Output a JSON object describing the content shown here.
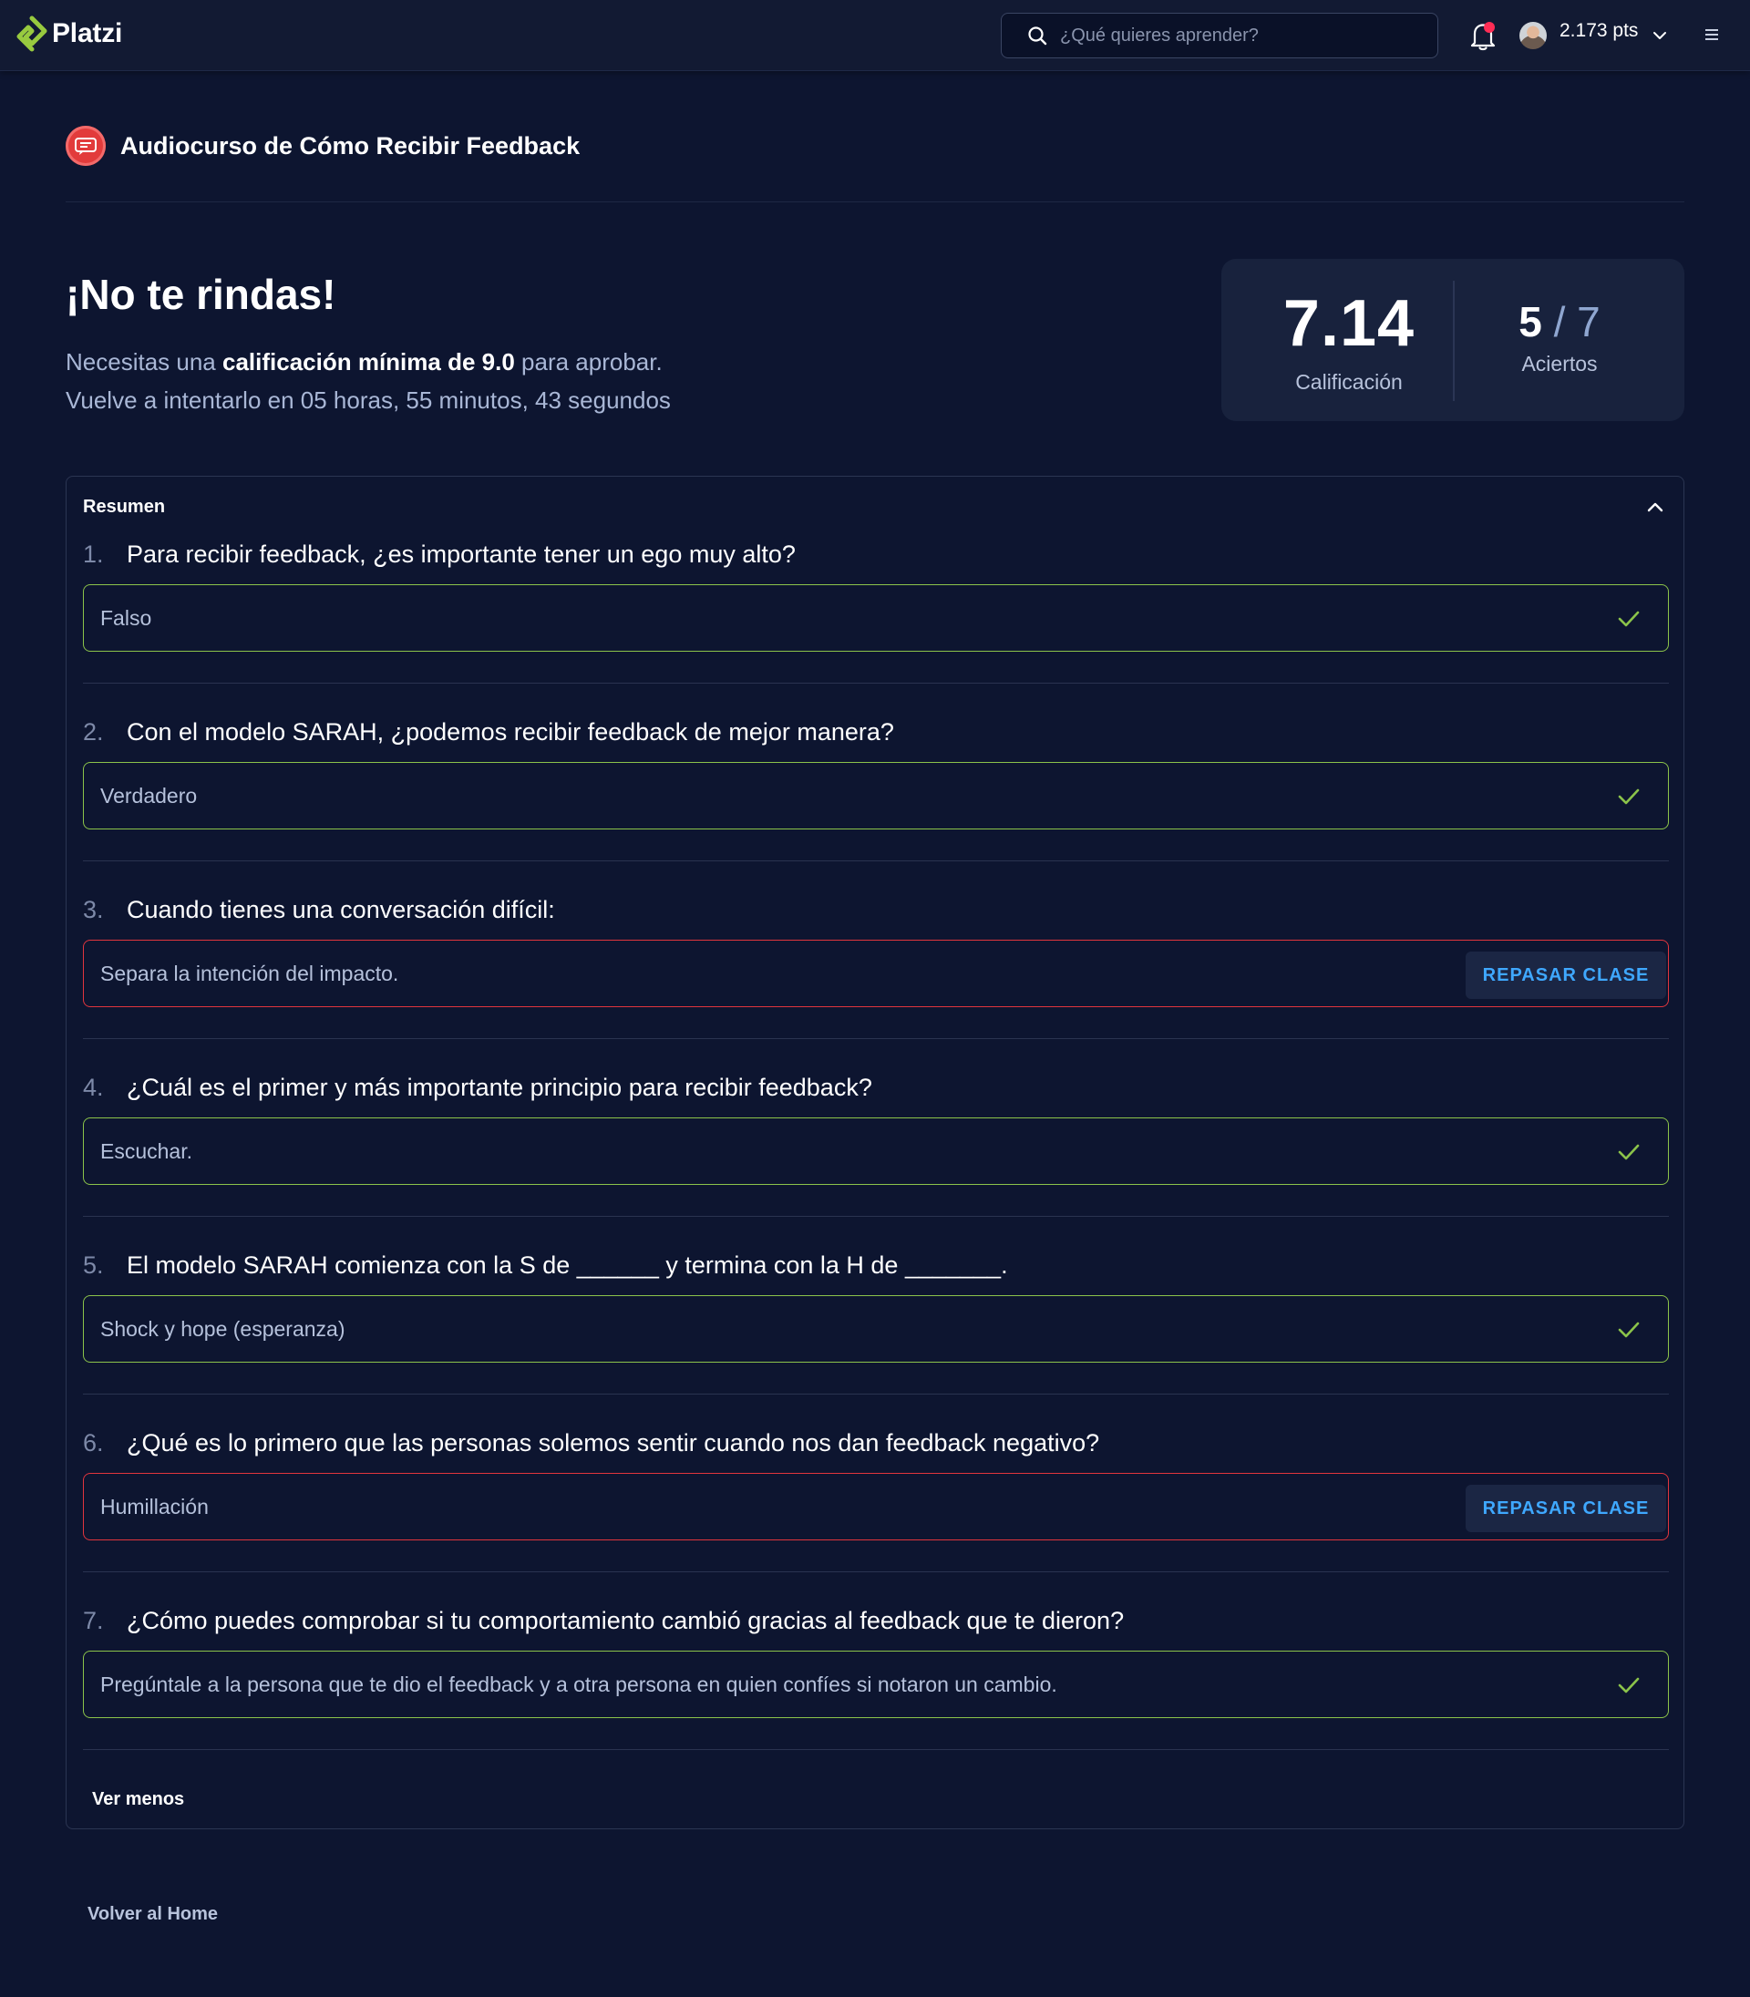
{
  "header": {
    "brand": "Platzi",
    "search_placeholder": "¿Qué quieres aprender?",
    "points": "2.173 pts",
    "accent_color": "#98ca3f",
    "notification_dot_color": "#ff2d55"
  },
  "course": {
    "title": "Audiocurso de Cómo Recibir Feedback",
    "badge_color": "#e23b3b"
  },
  "result": {
    "headline": "¡No te rindas!",
    "requirement_prefix": "Necesitas una ",
    "requirement_bold": "calificación mínima de 9.0",
    "requirement_suffix": " para aprobar.",
    "retry_text": "Vuelve a intentarlo en 05 horas, 55 minutos, 43 segundos",
    "grade": "7.14",
    "grade_label": "Calificación",
    "hits_correct": "5",
    "hits_separator": " / ",
    "hits_total": "7",
    "hits_label": "Aciertos"
  },
  "summary": {
    "title": "Resumen",
    "review_label": "REPASAR CLASE",
    "less_label": "Ver menos",
    "correct_color": "#8bc34a",
    "wrong_color": "#e0353d",
    "questions": [
      {
        "number": "1.",
        "text": "Para recibir feedback, ¿es importante tener un ego muy alto?",
        "answer": "Falso",
        "correct": true
      },
      {
        "number": "2.",
        "text": "Con el modelo SARAH, ¿podemos recibir feedback de mejor manera?",
        "answer": "Verdadero",
        "correct": true
      },
      {
        "number": "3.",
        "text": "Cuando tienes una conversación difícil:",
        "answer": "Separa la intención del impacto.",
        "correct": false
      },
      {
        "number": "4.",
        "text": "¿Cuál es el primer y más importante principio para recibir feedback?",
        "answer": "Escuchar.",
        "correct": true
      },
      {
        "number": "5.",
        "text": "El modelo SARAH comienza con la S de ______ y termina con la H de _______.",
        "answer": "Shock y hope (esperanza)",
        "correct": true
      },
      {
        "number": "6.",
        "text": "¿Qué es lo primero que las personas solemos sentir cuando nos dan feedback negativo?",
        "answer": "Humillación",
        "correct": false
      },
      {
        "number": "7.",
        "text": "¿Cómo puedes comprobar si tu comportamiento cambió gracias al feedback que te dieron?",
        "answer": "Pregúntale a la persona que te dio el feedback y a otra persona en quien confíes si notaron un cambio.",
        "correct": true
      }
    ]
  },
  "footer": {
    "back_home": "Volver al Home"
  }
}
